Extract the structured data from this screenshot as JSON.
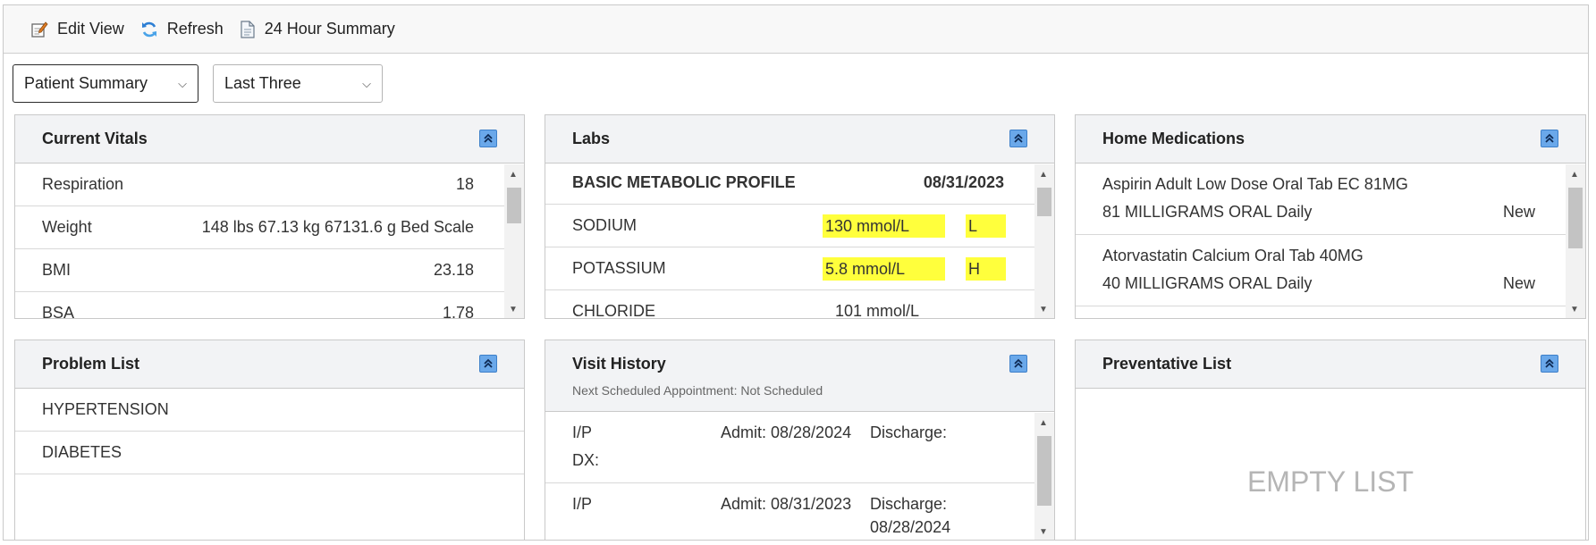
{
  "toolbar": {
    "edit_view": "Edit View",
    "refresh": "Refresh",
    "summary_24h": "24 Hour Summary"
  },
  "filters": {
    "view_select": "Patient Summary",
    "range_select": "Last Three"
  },
  "vitals": {
    "title": "Current Vitals",
    "rows": [
      {
        "label": "Respiration",
        "value": "18"
      },
      {
        "label": "Weight",
        "value": "148 lbs 67.13 kg 67131.6 g Bed Scale"
      },
      {
        "label": "BMI",
        "value": "23.18"
      },
      {
        "label": "BSA",
        "value": "1.78"
      }
    ]
  },
  "labs": {
    "title": "Labs",
    "group": "BASIC METABOLIC PROFILE",
    "date": "08/31/2023",
    "rows": [
      {
        "name": "SODIUM",
        "value": "130 mmol/L",
        "flag": "L"
      },
      {
        "name": "POTASSIUM",
        "value": "5.8 mmol/L",
        "flag": "H"
      },
      {
        "name": "CHLORIDE",
        "value": "101 mmol/L",
        "flag": ""
      }
    ],
    "highlight_color": "#ffff3c"
  },
  "meds": {
    "title": "Home Medications",
    "items": [
      {
        "name": "Aspirin Adult Low Dose Oral Tab EC 81MG",
        "dose": "81 MILLIGRAMS ORAL Daily",
        "status": "New"
      },
      {
        "name": "Atorvastatin Calcium Oral Tab 40MG",
        "dose": "40 MILLIGRAMS ORAL Daily",
        "status": "New"
      }
    ]
  },
  "problems": {
    "title": "Problem List",
    "items": [
      "HYPERTENSION",
      "DIABETES"
    ]
  },
  "visits": {
    "title": "Visit History",
    "subtitle": "Next Scheduled Appointment: Not Scheduled",
    "items": [
      {
        "type": "I/P",
        "admit": "Admit: 08/28/2024",
        "discharge_label": "Discharge:",
        "discharge_date": "",
        "dx": "DX:"
      },
      {
        "type": "I/P",
        "admit": "Admit: 08/31/2023",
        "discharge_label": "Discharge:",
        "discharge_date": "08/28/2024",
        "dx": ""
      }
    ]
  },
  "preventative": {
    "title": "Preventative List",
    "empty": "EMPTY LIST"
  },
  "icons": {
    "edit": "edit-view-icon",
    "refresh": "refresh-icon",
    "document": "document-icon",
    "collapse": "collapse-up-icon"
  }
}
